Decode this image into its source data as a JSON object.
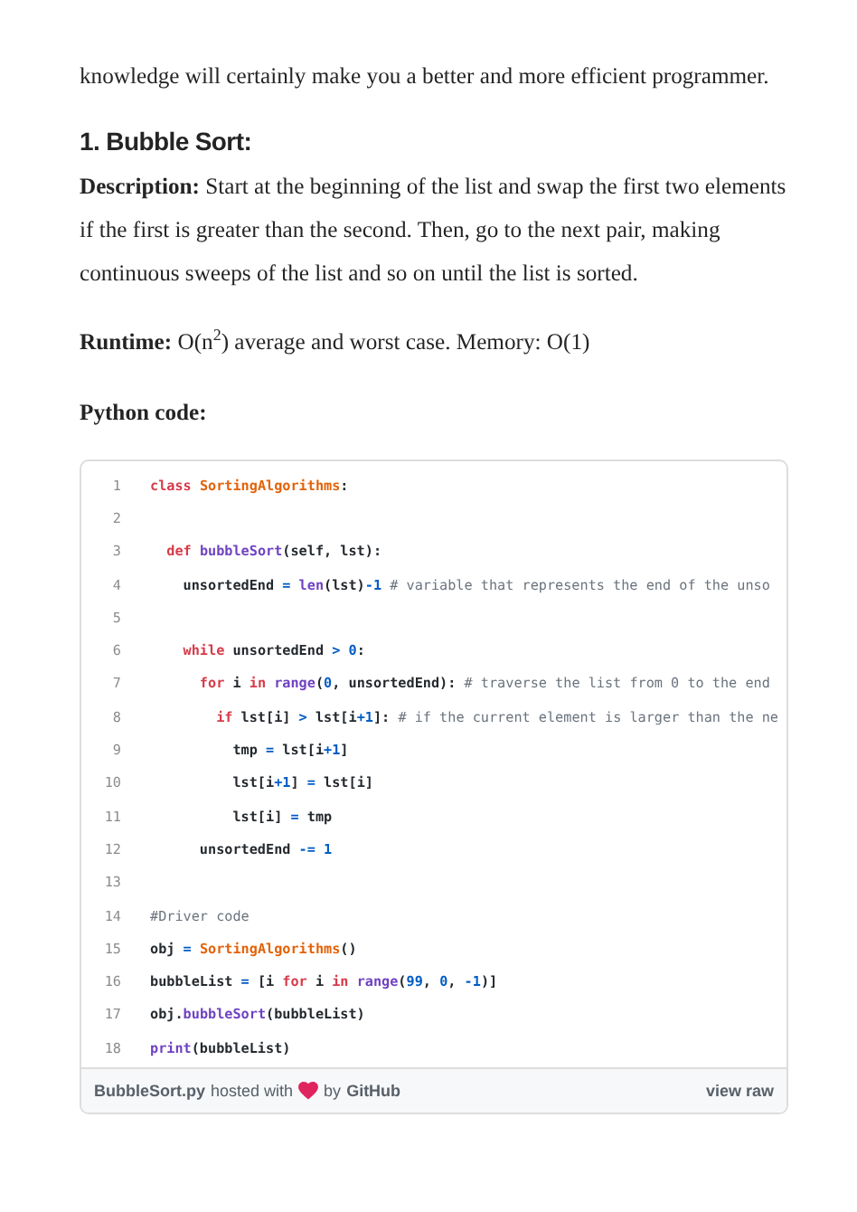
{
  "intro": "knowledge will certainly make you a better and more efficient programmer.",
  "heading": "1. Bubble Sort:",
  "description": "**Description:** Start at the beginning of the list and swap the first two elements if the first is greater than the second. Then, go to the next pair, making continuous sweeps of the list and so on until the list is sorted.",
  "runtime": "**Runtime:** O(n$^{2}$) average and worst case. Memory: O(1)",
  "code_label": "Python code:",
  "gist": {
    "lines": [
      {
        "number": "1",
        "tokens": [
          {
            "kind": "keyword",
            "text": "class "
          },
          {
            "kind": "title",
            "text": "SortingAlgorithms"
          },
          {
            "kind": "plain",
            "text": ":"
          }
        ]
      },
      {
        "number": "2"
      },
      {
        "number": "3",
        "tokens": [
          {
            "kind": "keyword",
            "text": "  def "
          },
          {
            "kind": "func",
            "text": "bubbleSort"
          },
          {
            "kind": "plain",
            "text": "(self, lst):"
          }
        ]
      },
      {
        "number": "4",
        "tokens": [
          {
            "kind": "plain",
            "text": "    unsortedEnd"
          },
          {
            "kind": "op",
            "text": " = "
          },
          {
            "kind": "func",
            "text": "len"
          },
          {
            "kind": "plain",
            "text": "(lst)"
          },
          {
            "kind": "op",
            "text": "-"
          },
          {
            "kind": "number",
            "text": "1"
          },
          {
            "kind": "comment",
            "text": " # variable that represents the end of the unso"
          }
        ]
      },
      {
        "number": "5"
      },
      {
        "number": "6",
        "tokens": [
          {
            "kind": "keyword",
            "text": "    while"
          },
          {
            "kind": "plain",
            "text": " unsortedEnd"
          },
          {
            "kind": "op",
            "text": " > "
          },
          {
            "kind": "number",
            "text": "0"
          },
          {
            "kind": "plain",
            "text": ":"
          }
        ]
      },
      {
        "number": "7",
        "tokens": [
          {
            "kind": "keyword",
            "text": "      for"
          },
          {
            "kind": "plain",
            "text": " i "
          },
          {
            "kind": "keyword",
            "text": "in "
          },
          {
            "kind": "func",
            "text": "range"
          },
          {
            "kind": "plain",
            "text": "("
          },
          {
            "kind": "number",
            "text": "0"
          },
          {
            "kind": "plain",
            "text": ", unsortedEnd):"
          },
          {
            "kind": "comment",
            "text": " # traverse the list from 0 to the end"
          }
        ]
      },
      {
        "number": "8",
        "tokens": [
          {
            "kind": "keyword",
            "text": "        if"
          },
          {
            "kind": "plain",
            "text": " lst[i]"
          },
          {
            "kind": "op",
            "text": " > "
          },
          {
            "kind": "plain",
            "text": "lst[i"
          },
          {
            "kind": "op",
            "text": "+"
          },
          {
            "kind": "number",
            "text": "1"
          },
          {
            "kind": "plain",
            "text": "]:"
          },
          {
            "kind": "comment",
            "text": " # if the current element is larger than the ne"
          }
        ]
      },
      {
        "number": "9",
        "tokens": [
          {
            "kind": "plain",
            "text": "          tmp"
          },
          {
            "kind": "op",
            "text": " = "
          },
          {
            "kind": "plain",
            "text": "lst[i"
          },
          {
            "kind": "op",
            "text": "+"
          },
          {
            "kind": "number",
            "text": "1"
          },
          {
            "kind": "plain",
            "text": "]"
          }
        ]
      },
      {
        "number": "10",
        "tokens": [
          {
            "kind": "plain",
            "text": "          lst[i"
          },
          {
            "kind": "op",
            "text": "+"
          },
          {
            "kind": "number",
            "text": "1"
          },
          {
            "kind": "plain",
            "text": "]"
          },
          {
            "kind": "op",
            "text": " = "
          },
          {
            "kind": "plain",
            "text": "lst[i]"
          }
        ]
      },
      {
        "number": "11",
        "tokens": [
          {
            "kind": "plain",
            "text": "          lst[i]"
          },
          {
            "kind": "op",
            "text": " = "
          },
          {
            "kind": "plain",
            "text": "tmp"
          }
        ]
      },
      {
        "number": "12",
        "tokens": [
          {
            "kind": "plain",
            "text": "      unsortedEnd"
          },
          {
            "kind": "op",
            "text": " -= "
          },
          {
            "kind": "number",
            "text": "1"
          }
        ]
      },
      {
        "number": "13"
      },
      {
        "number": "14",
        "tokens": [
          {
            "kind": "comment",
            "text": "#Driver code"
          }
        ]
      },
      {
        "number": "15",
        "tokens": [
          {
            "kind": "plain",
            "text": "obj"
          },
          {
            "kind": "op",
            "text": " = "
          },
          {
            "kind": "title",
            "text": "SortingAlgorithms"
          },
          {
            "kind": "plain",
            "text": "()"
          }
        ]
      },
      {
        "number": "16",
        "tokens": [
          {
            "kind": "plain",
            "text": "bubbleList"
          },
          {
            "kind": "op",
            "text": " = "
          },
          {
            "kind": "plain",
            "text": "[i "
          },
          {
            "kind": "keyword",
            "text": "for"
          },
          {
            "kind": "plain",
            "text": " i "
          },
          {
            "kind": "keyword",
            "text": "in "
          },
          {
            "kind": "func",
            "text": "range"
          },
          {
            "kind": "plain",
            "text": "("
          },
          {
            "kind": "number",
            "text": "99"
          },
          {
            "kind": "plain",
            "text": ", "
          },
          {
            "kind": "number",
            "text": "0"
          },
          {
            "kind": "plain",
            "text": ", "
          },
          {
            "kind": "op",
            "text": "-"
          },
          {
            "kind": "number",
            "text": "1"
          },
          {
            "kind": "plain",
            "text": ")]"
          }
        ]
      },
      {
        "number": "17",
        "tokens": [
          {
            "kind": "plain",
            "text": "obj."
          },
          {
            "kind": "func",
            "text": "bubbleSort"
          },
          {
            "kind": "plain",
            "text": "(bubbleList)"
          }
        ]
      },
      {
        "number": "18",
        "tokens": [
          {
            "kind": "func",
            "text": "print"
          },
          {
            "kind": "plain",
            "text": "(bubbleList)"
          }
        ]
      }
    ],
    "footer": {
      "file": "BubbleSort.py",
      "hosted": "hosted with",
      "by": "by",
      "host": "GitHub",
      "view_raw": "view raw"
    }
  }
}
